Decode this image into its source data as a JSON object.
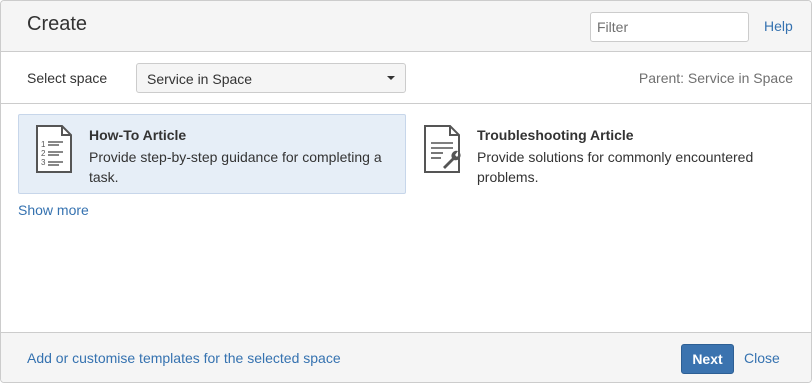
{
  "dialog": {
    "title": "Create",
    "filter": {
      "placeholder": "Filter",
      "value": ""
    },
    "help_label": "Help"
  },
  "space": {
    "label": "Select space",
    "selected": "Service in Space",
    "parent": "Parent: Service in Space"
  },
  "templates": [
    {
      "name": "How-To Article",
      "description": "Provide step-by-step guidance for completing a task.",
      "icon": "numbered-list-document-icon",
      "selected": true
    },
    {
      "name": "Troubleshooting Article",
      "description": "Provide solutions for commonly encountered problems.",
      "icon": "wrench-document-icon",
      "selected": false
    }
  ],
  "show_more": "Show more",
  "footer": {
    "customise_link": "Add or customise templates for the selected space",
    "next_label": "Next",
    "close_label": "Close"
  },
  "colors": {
    "accent": "#3b73af",
    "link": "#3572b0",
    "selected_bg": "#e6eef7",
    "header_bg": "#f5f5f5"
  }
}
